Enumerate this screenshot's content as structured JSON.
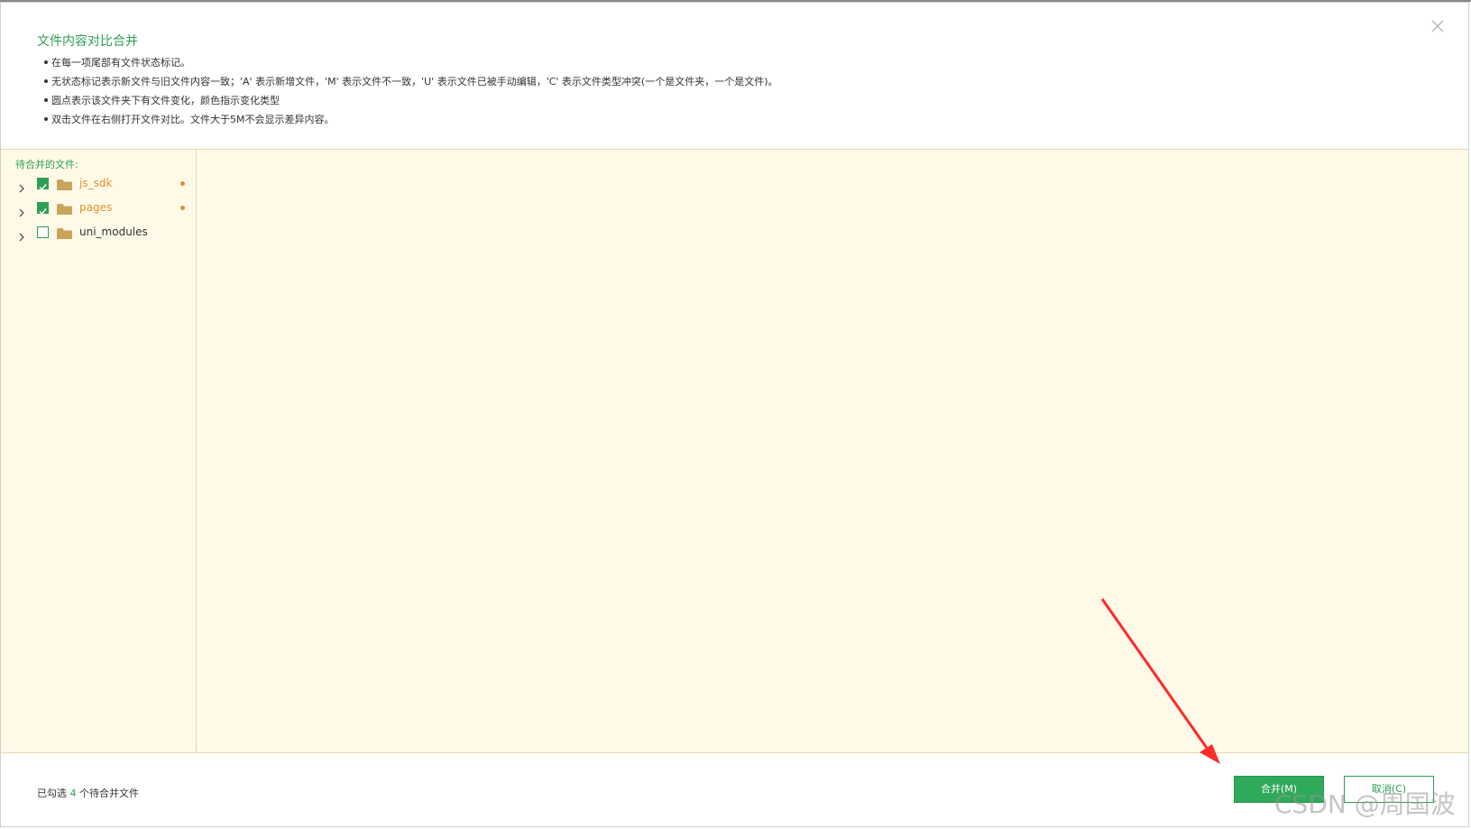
{
  "dialog": {
    "title": "文件内容对比合并",
    "notes": [
      "在每一项尾部有文件状态标记。",
      "无状态标记表示新文件与旧文件内容一致；'A' 表示新增文件，'M' 表示文件不一致，'U' 表示文件已被手动编辑，'C' 表示文件类型冲突(一个是文件夹，一个是文件)。",
      "圆点表示该文件夹下有文件变化，颜色指示变化类型",
      "双击文件在右侧打开文件对比。文件大于5M不会显示差异内容。"
    ],
    "close_icon": "close-icon"
  },
  "tree": {
    "label": "待合并的文件:",
    "items": [
      {
        "name": "js_sdk",
        "checked": true,
        "has_changes": true
      },
      {
        "name": "pages",
        "checked": true,
        "has_changes": true
      },
      {
        "name": "uni_modules",
        "checked": false,
        "has_changes": false
      }
    ]
  },
  "footer": {
    "summary_prefix": "已勾选",
    "selected_count": "4",
    "summary_suffix": "个待合并文件",
    "merge_label": "合并(M)",
    "cancel_label": "取消(C)"
  },
  "watermark": "CSDN @周国波",
  "colors": {
    "accent": "#2fa95a",
    "changed": "#e0912b",
    "panel_bg": "#fffae8",
    "annotation_arrow": "#ff2a2a"
  }
}
